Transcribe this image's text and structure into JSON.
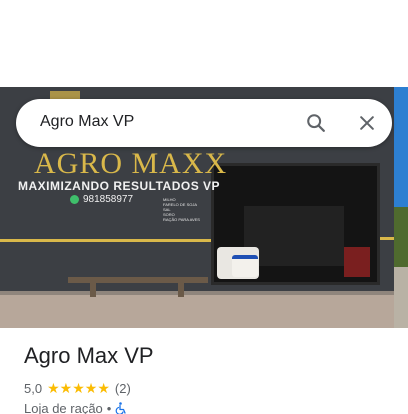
{
  "search": {
    "query": "Agro Max VP"
  },
  "photo": {
    "sign_title": "AGRO MAXX",
    "sign_subtitle": "MAXIMIZANDO RESULTADOS VP",
    "sign_phone": "981858977",
    "sign_items": [
      "MILHO",
      "FARELO DE SOJA",
      "SAL",
      "SORO",
      "RAÇÃO PARA AVES"
    ]
  },
  "place": {
    "name": "Agro Max VP",
    "rating": "5,0",
    "stars": 5,
    "review_count": "(2)",
    "category": "Loja de ração",
    "separator": "•",
    "accessibility_icon": "wheelchair-icon"
  },
  "colors": {
    "star": "#fbbc04",
    "accent": "#1a73e8",
    "text_primary": "#202124",
    "text_secondary": "#5f6368",
    "sign_yellow": "#d9b84a"
  }
}
